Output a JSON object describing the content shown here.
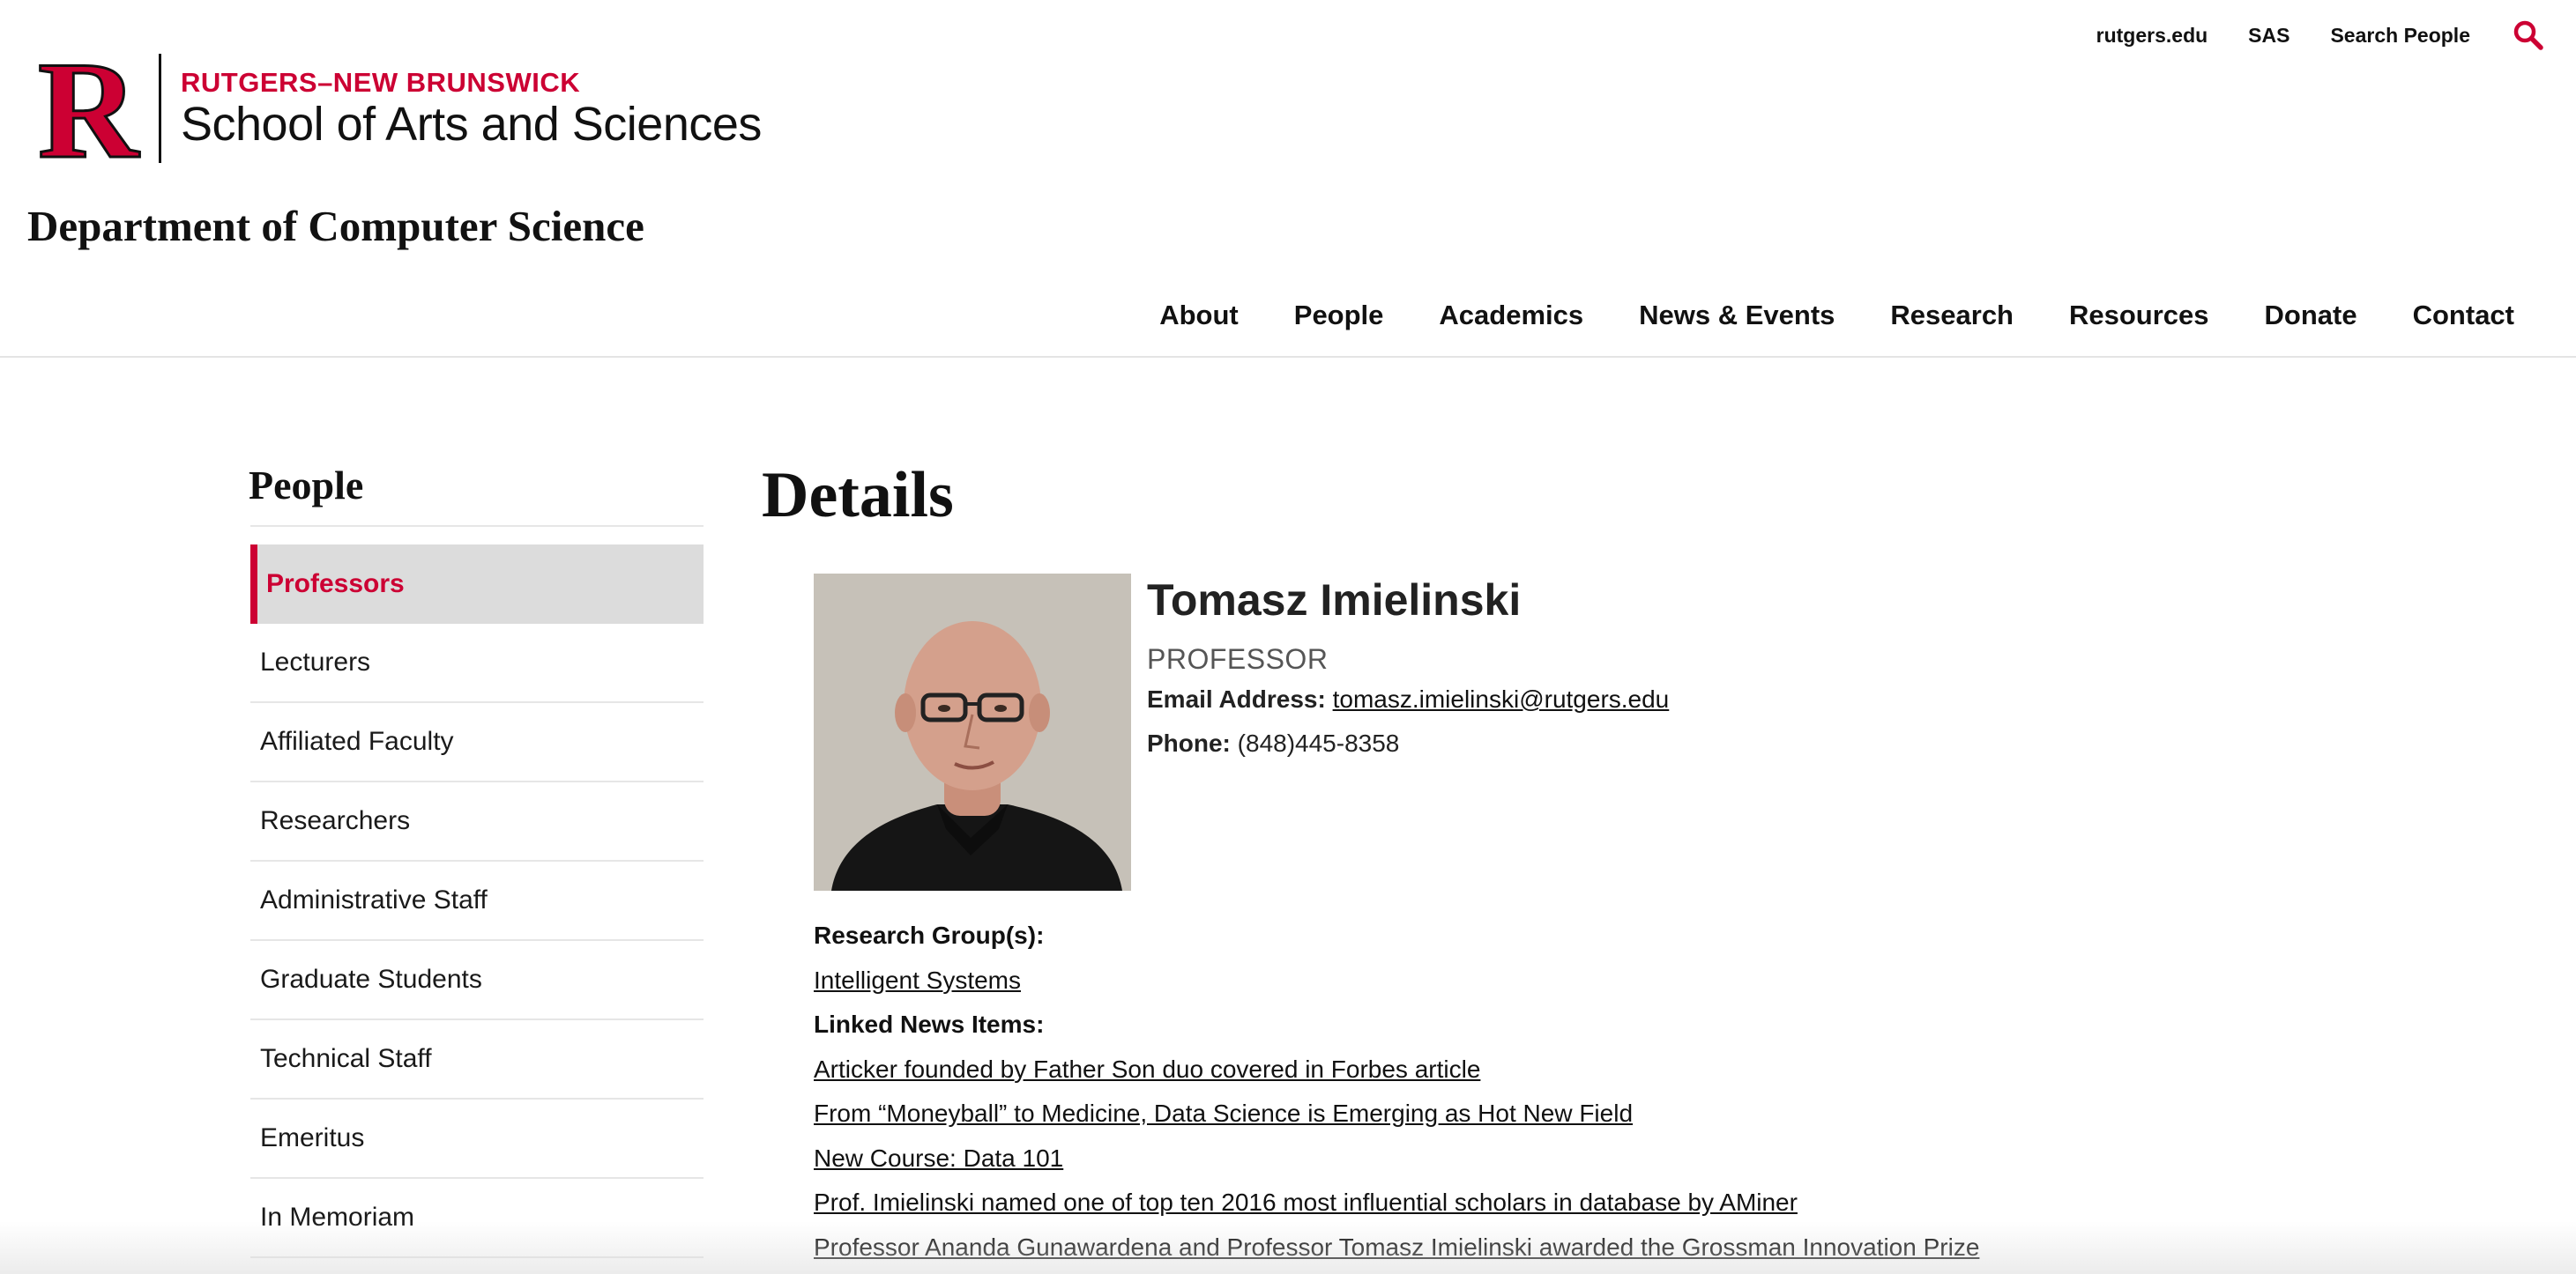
{
  "header": {
    "utility_links": [
      "rutgers.edu",
      "SAS",
      "Search People"
    ],
    "search_icon": "search-icon",
    "logo_letter": "R",
    "logo_sub": "RUTGERS–NEW BRUNSWICK",
    "logo_main": "School of Arts and Sciences",
    "department": "Department of Computer Science",
    "nav": [
      "About",
      "People",
      "Academics",
      "News & Events",
      "Research",
      "Resources",
      "Donate",
      "Contact"
    ]
  },
  "colors": {
    "brand_red": "#cc0033",
    "active_bg": "#dcdcdc"
  },
  "sidebar": {
    "title": "People",
    "items": [
      {
        "label": "Professors",
        "active": true
      },
      {
        "label": "Lecturers",
        "active": false
      },
      {
        "label": "Affiliated Faculty",
        "active": false
      },
      {
        "label": "Researchers",
        "active": false
      },
      {
        "label": "Administrative Staff",
        "active": false
      },
      {
        "label": "Graduate Students",
        "active": false
      },
      {
        "label": "Technical Staff",
        "active": false
      },
      {
        "label": "Emeritus",
        "active": false
      },
      {
        "label": "In Memoriam",
        "active": false
      }
    ]
  },
  "main": {
    "heading": "Details",
    "person": {
      "name": "Tomasz Imielinski",
      "title": "PROFESSOR",
      "email_label": "Email Address:",
      "email": "tomasz.imielinski@rutgers.edu",
      "phone_label": "Phone:",
      "phone": "(848)445-8358"
    },
    "research_groups_label": "Research Group(s):",
    "research_groups": [
      "Intelligent Systems"
    ],
    "linked_news_label": "Linked News Items:",
    "linked_news": [
      "Articker founded by Father Son duo covered in Forbes article",
      "From “Moneyball” to Medicine, Data Science is Emerging as Hot New Field",
      "New Course: Data 101",
      "Prof. Imielinski named one of top ten 2016 most influential scholars in database by AMiner",
      "Professor Ananda Gunawardena and Professor Tomasz Imielinski awarded the Grossman Innovation Prize"
    ]
  }
}
